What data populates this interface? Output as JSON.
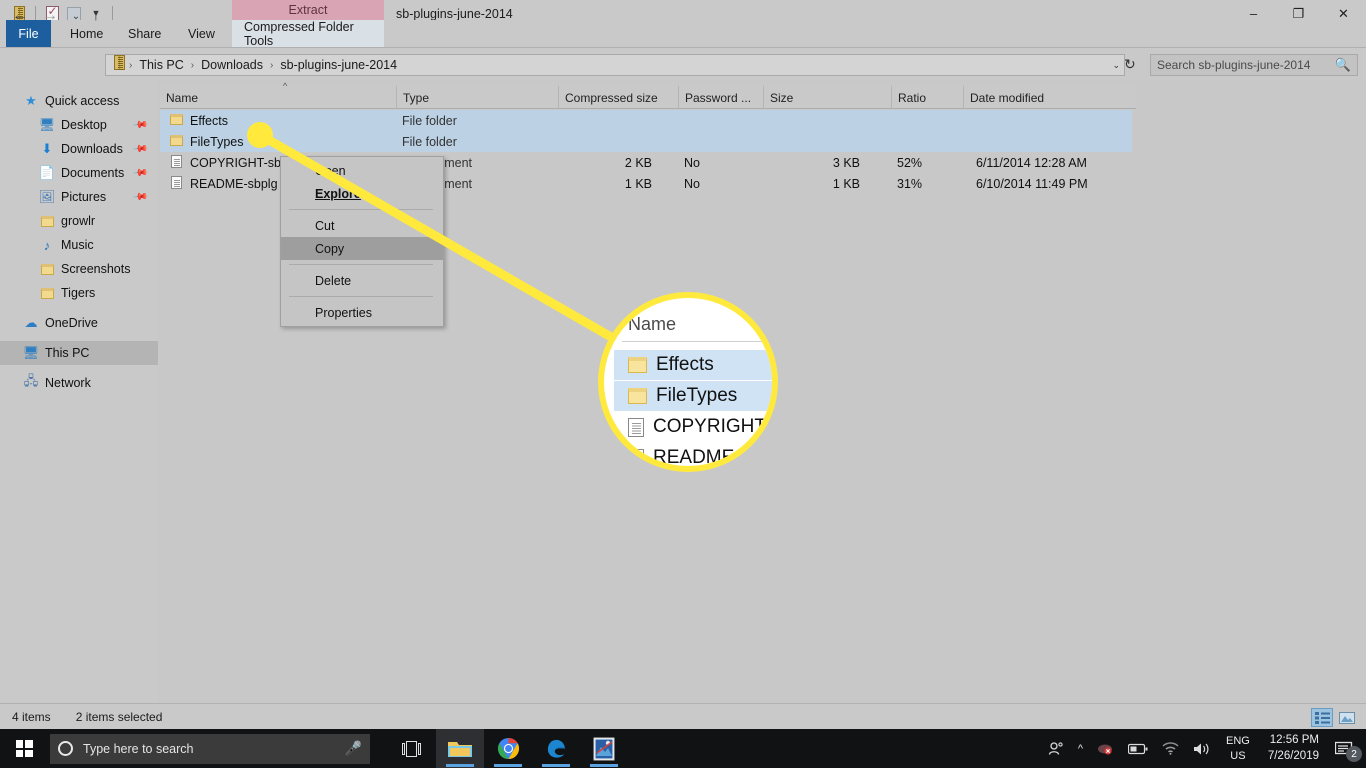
{
  "window": {
    "title": "sb-plugins-june-2014",
    "contextual_tab_group": "Extract",
    "minimize": "–",
    "maximize": "❐",
    "close": "✕"
  },
  "quick_access_toolbar": {
    "items": [
      {
        "name": "archive-icon",
        "label": ""
      },
      {
        "name": "properties-icon",
        "label": ""
      },
      {
        "name": "new-folder-icon",
        "label": ""
      },
      {
        "name": "customize-dropdown-icon",
        "label": "▼"
      }
    ]
  },
  "ribbon": {
    "tabs": [
      {
        "label": "File",
        "selected": false,
        "kind": "file"
      },
      {
        "label": "Home",
        "selected": false,
        "kind": "normal"
      },
      {
        "label": "Share",
        "selected": false,
        "kind": "normal"
      },
      {
        "label": "View",
        "selected": false,
        "kind": "normal"
      },
      {
        "label": "Compressed Folder Tools",
        "selected": true,
        "kind": "contextual"
      }
    ]
  },
  "navigation": {
    "back": "←",
    "forward": "→",
    "recent_locations": "⌄",
    "up": "↑",
    "breadcrumbs": [
      "This PC",
      "Downloads",
      "sb-plugins-june-2014"
    ],
    "separator": "›",
    "path_dropdown": "⌄",
    "refresh": "↻"
  },
  "search": {
    "placeholder": "Search sb-plugins-june-2014",
    "icon": "search-icon"
  },
  "sidebar": {
    "groups": [
      {
        "header": {
          "label": "Quick access",
          "icon": "star-icon"
        },
        "items": [
          {
            "label": "Desktop",
            "icon": "desktop-icon",
            "pinned": true
          },
          {
            "label": "Downloads",
            "icon": "download-arrow-icon",
            "pinned": true
          },
          {
            "label": "Documents",
            "icon": "documents-icon",
            "pinned": true
          },
          {
            "label": "Pictures",
            "icon": "pictures-icon",
            "pinned": true
          },
          {
            "label": "growlr",
            "icon": "folder-icon",
            "pinned": false
          },
          {
            "label": "Music",
            "icon": "music-note-icon",
            "pinned": false
          },
          {
            "label": "Screenshots",
            "icon": "folder-icon",
            "pinned": false
          },
          {
            "label": "Tigers",
            "icon": "folder-icon",
            "pinned": false
          }
        ]
      },
      {
        "header": {
          "label": "OneDrive",
          "icon": "cloud-icon"
        },
        "items": []
      },
      {
        "header": {
          "label": "This PC",
          "icon": "this-pc-icon",
          "selected": true
        },
        "items": []
      },
      {
        "header": {
          "label": "Network",
          "icon": "network-icon"
        },
        "items": []
      }
    ]
  },
  "file_list": {
    "columns": [
      {
        "label": "Name",
        "sorted": true,
        "sort_caret": "^"
      },
      {
        "label": "Type"
      },
      {
        "label": "Compressed size"
      },
      {
        "label": "Password ..."
      },
      {
        "label": "Size"
      },
      {
        "label": "Ratio"
      },
      {
        "label": "Date modified"
      }
    ],
    "rows": [
      {
        "name": "Effects",
        "icon": "folder-icon",
        "type": "File folder",
        "compressed_size": "",
        "password": "",
        "size": "",
        "ratio": "",
        "date_modified": "",
        "selected": true
      },
      {
        "name": "FileTypes",
        "icon": "folder-icon",
        "type": "File folder",
        "compressed_size": "",
        "password": "",
        "size": "",
        "ratio": "",
        "date_modified": "",
        "selected": true
      },
      {
        "name": "COPYRIGHT-sb",
        "icon": "document-icon",
        "type": "cument",
        "compressed_size": "2 KB",
        "password": "No",
        "size": "3 KB",
        "ratio": "52%",
        "date_modified": "6/11/2014 12:28 AM",
        "selected": false
      },
      {
        "name": "README-sbplg",
        "icon": "document-icon",
        "type": "cument",
        "compressed_size": "1 KB",
        "password": "No",
        "size": "1 KB",
        "ratio": "31%",
        "date_modified": "6/10/2014 11:49 PM",
        "selected": false
      }
    ]
  },
  "context_menu": {
    "items": [
      {
        "label": "Open",
        "bold": false,
        "highlighted": false,
        "separator_after": false
      },
      {
        "label": "Explore",
        "bold": true,
        "highlighted": false,
        "separator_after": true
      },
      {
        "label": "Cut",
        "bold": false,
        "highlighted": false,
        "separator_after": false
      },
      {
        "label": "Copy",
        "bold": false,
        "highlighted": true,
        "separator_after": true
      },
      {
        "label": "Delete",
        "bold": false,
        "highlighted": false,
        "separator_after": true
      },
      {
        "label": "Properties",
        "bold": false,
        "highlighted": false,
        "separator_after": false
      }
    ]
  },
  "callout": {
    "accent_color": "#ffe93d",
    "magnified_header": "Name",
    "magnified_rows": [
      {
        "label": "Effects",
        "icon": "folder-icon",
        "selected": true
      },
      {
        "label": "FileTypes",
        "icon": "folder-icon",
        "selected": true
      },
      {
        "label": "COPYRIGHT-",
        "icon": "document-icon",
        "selected": false
      },
      {
        "label": "README",
        "icon": "document-icon",
        "selected": false
      }
    ]
  },
  "status_bar": {
    "item_count": "4 items",
    "selection_count": "2 items selected",
    "views": [
      {
        "name": "details-view",
        "active": true
      },
      {
        "name": "large-icons-view",
        "active": false
      }
    ]
  },
  "taskbar": {
    "start_label": "",
    "search_placeholder": "Type here to search",
    "search_icon": "cortana-circle-icon",
    "mic_icon": "microphone-icon",
    "buttons": [
      {
        "name": "task-view-icon",
        "running": false,
        "active": false
      },
      {
        "name": "file-explorer-icon",
        "running": true,
        "active": true
      },
      {
        "name": "chrome-icon",
        "running": true,
        "active": false
      },
      {
        "name": "edge-icon",
        "running": true,
        "active": false
      },
      {
        "name": "photos-icon",
        "running": true,
        "active": false
      }
    ],
    "tray": {
      "people_icon": "people-icon",
      "show_hidden_icon": "chevron-up-icon",
      "onedrive_icon": "onedrive-status-icon",
      "battery_icon": "battery-icon",
      "network_icon": "wifi-icon",
      "volume_icon": "speaker-icon",
      "language": "ENG",
      "locale": "US",
      "time": "12:56 PM",
      "date": "7/26/2019",
      "notification_icon": "notification-icon",
      "notification_count": "2"
    }
  },
  "colors": {
    "window_chrome": "#c9c9c9",
    "file_tab": "#1d5f9e",
    "contextual_tab_header": "#d9a5b4",
    "contextual_tab": "#d9e0e6",
    "row_selected": "#bcd1e4",
    "callout_yellow": "#ffe93d",
    "taskbar": "#111214"
  }
}
